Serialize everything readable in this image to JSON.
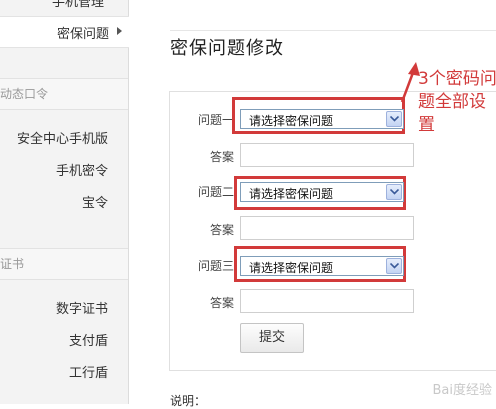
{
  "sidebar": {
    "top_cut_label": "手机管理",
    "active_item": "密保问题",
    "section1": "动态口令",
    "section1_items": [
      "安全中心手机版",
      "手机密令",
      "宝令"
    ],
    "section2": "证书",
    "section2_items": [
      "数字证书",
      "支付盾",
      "工行盾"
    ]
  },
  "main": {
    "title": "密保问题修改",
    "rows": [
      {
        "question_label": "问题一",
        "select_value": "请选择密保问题",
        "answer_label": "答案",
        "answer_value": ""
      },
      {
        "question_label": "问题二",
        "select_value": "请选择密保问题",
        "answer_label": "答案",
        "answer_value": ""
      },
      {
        "question_label": "问题三",
        "select_value": "请选择密保问题",
        "answer_label": "答案",
        "answer_value": ""
      }
    ],
    "submit_label": "提交",
    "note_label": "说明："
  },
  "annotation": {
    "text": "3个密码问题全部设置",
    "color": "#d23a3a"
  },
  "watermark": "Bai度经验"
}
